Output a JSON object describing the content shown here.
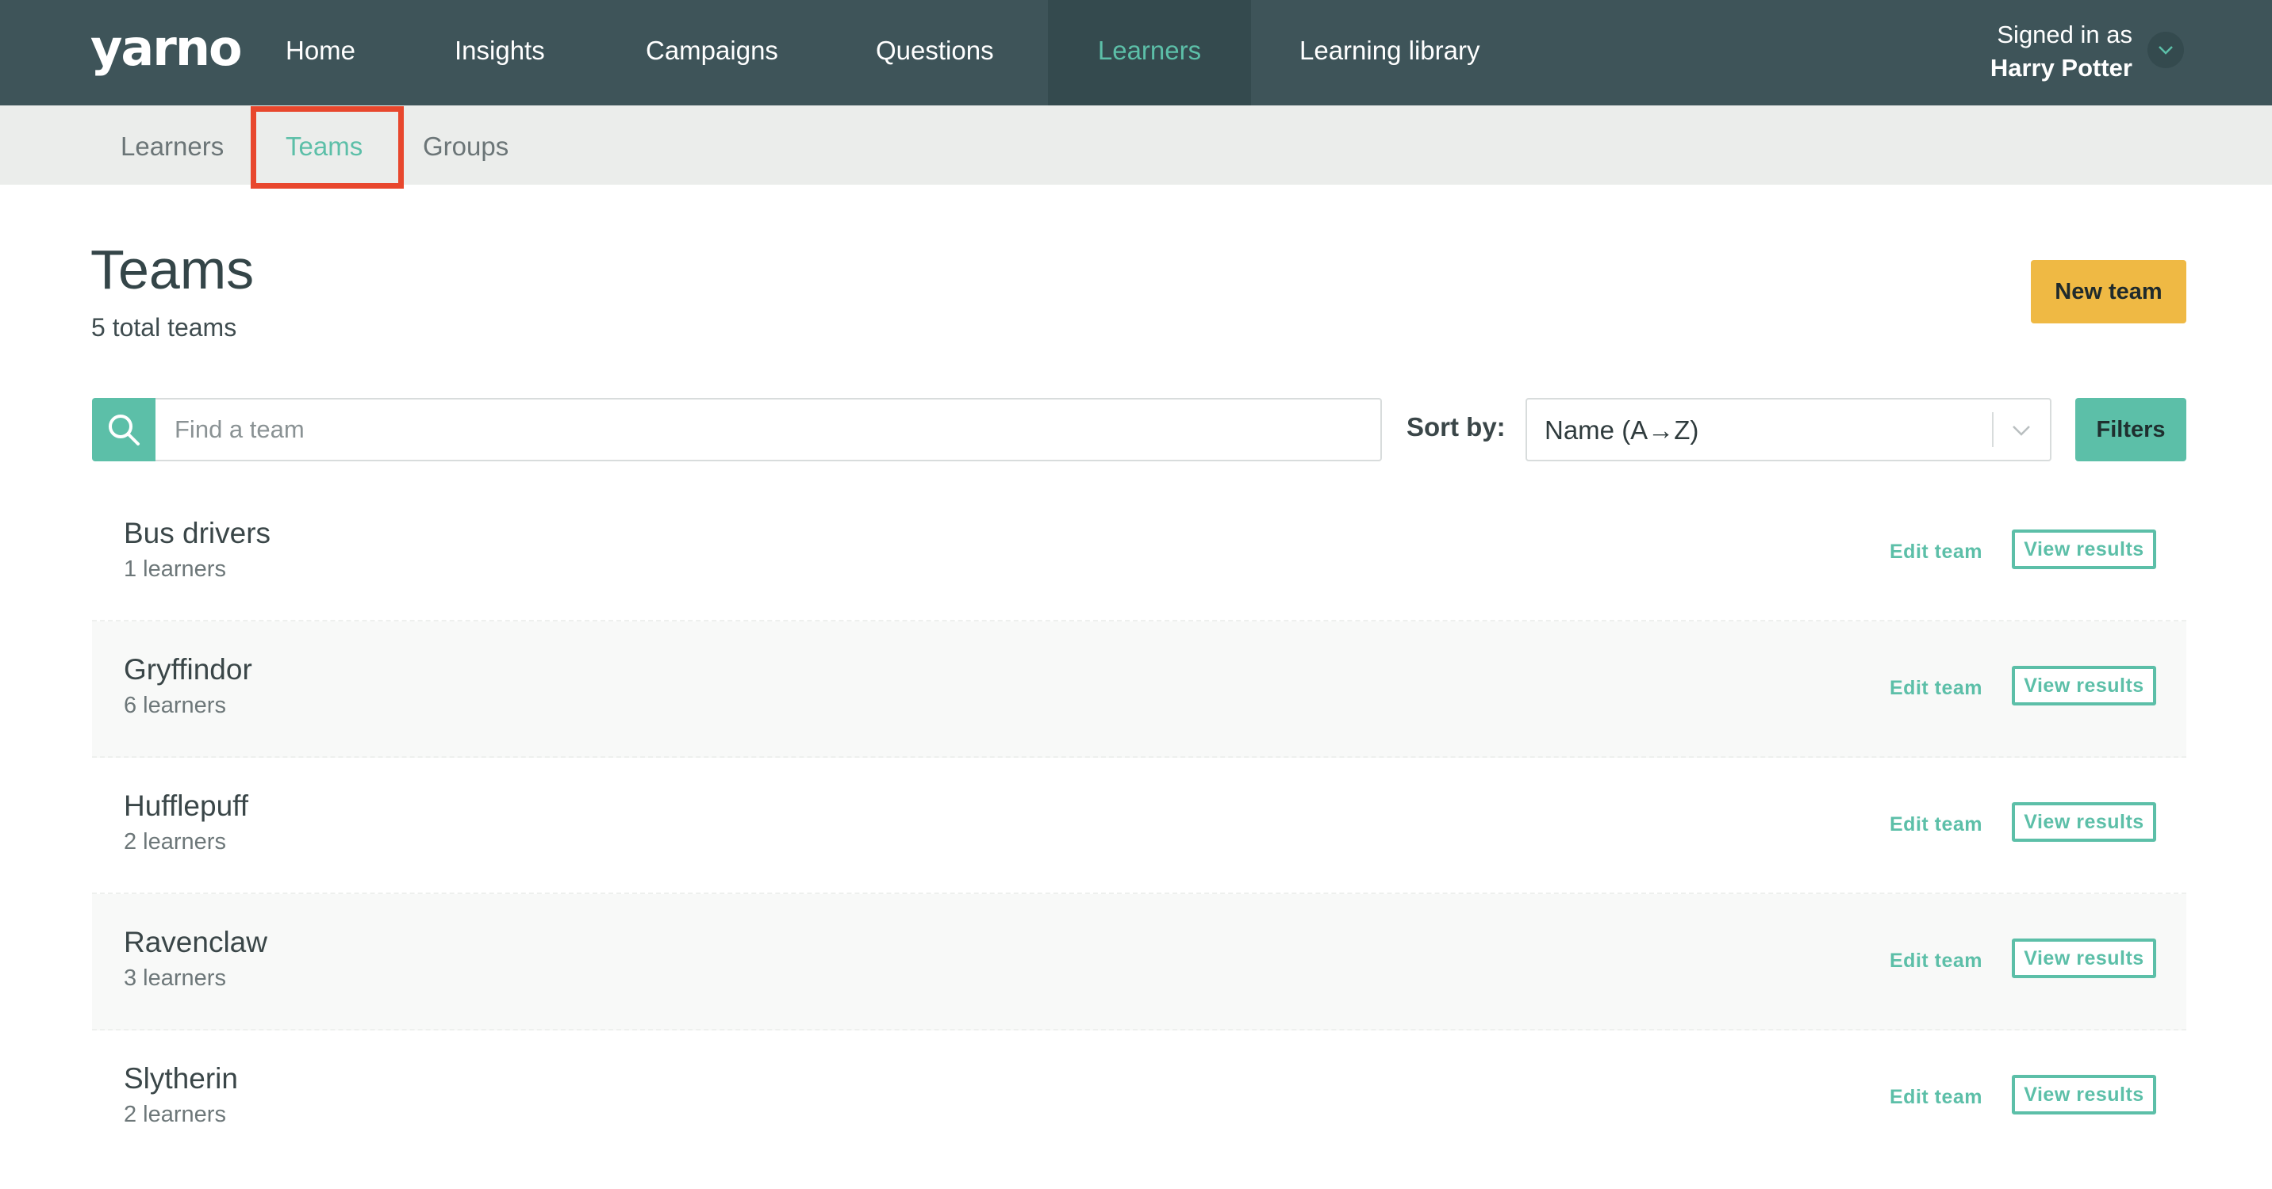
{
  "brand": {
    "logo_text": "yarno"
  },
  "nav": {
    "items": [
      {
        "label": "Home"
      },
      {
        "label": "Insights"
      },
      {
        "label": "Campaigns"
      },
      {
        "label": "Questions"
      },
      {
        "label": "Learners"
      },
      {
        "label": "Learning library"
      }
    ],
    "active": "Learners"
  },
  "user": {
    "signed_in_label": "Signed in as",
    "name": "Harry Potter"
  },
  "subnav": {
    "items": [
      {
        "label": "Learners"
      },
      {
        "label": "Teams"
      },
      {
        "label": "Groups"
      }
    ],
    "active": "Teams"
  },
  "page": {
    "title": "Teams",
    "subtitle": "5 total teams",
    "new_button": "New team"
  },
  "search": {
    "placeholder": "Find a team",
    "value": ""
  },
  "sort": {
    "label": "Sort by:",
    "value": "Name (A→Z)"
  },
  "filters_label": "Filters",
  "teams": [
    {
      "name": "Bus drivers",
      "count": "1 learners",
      "edit": "Edit team",
      "view": "View results"
    },
    {
      "name": "Gryffindor",
      "count": "6 learners",
      "edit": "Edit team",
      "view": "View results"
    },
    {
      "name": "Hufflepuff",
      "count": "2 learners",
      "edit": "Edit team",
      "view": "View results"
    },
    {
      "name": "Ravenclaw",
      "count": "3 learners",
      "edit": "Edit team",
      "view": "View results"
    },
    {
      "name": "Slytherin",
      "count": "2 learners",
      "edit": "Edit team",
      "view": "View results"
    }
  ],
  "colors": {
    "topbar": "#3e5459",
    "accent": "#5cbfa8",
    "primary_button": "#efb944",
    "highlight": "#e8472d"
  },
  "icons": {
    "search": "search-icon",
    "user_menu": "chevron-down-icon",
    "sort": "chevron-down-icon"
  }
}
